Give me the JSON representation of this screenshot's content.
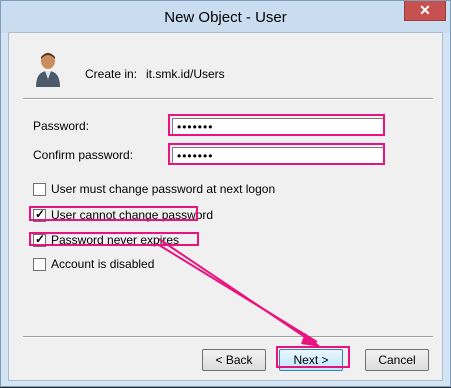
{
  "window": {
    "title": "New Object - User",
    "close_glyph": "✕"
  },
  "header": {
    "icon": "user-icon",
    "create_in_label": "Create in:",
    "create_in_value": "it.smk.id/Users"
  },
  "form": {
    "password_label": "Password:",
    "password_value": "•••••••",
    "confirm_label": "Confirm password:",
    "confirm_value": "•••••••"
  },
  "options": [
    {
      "label": "User must change password at next logon",
      "checked": false
    },
    {
      "label": "User cannot change password",
      "checked": true
    },
    {
      "label": "Password never expires",
      "checked": true
    },
    {
      "label": "Account is disabled",
      "checked": false
    }
  ],
  "buttons": {
    "back": "< Back",
    "next": "Next >",
    "cancel": "Cancel"
  },
  "annotation_color": "#e8137e"
}
